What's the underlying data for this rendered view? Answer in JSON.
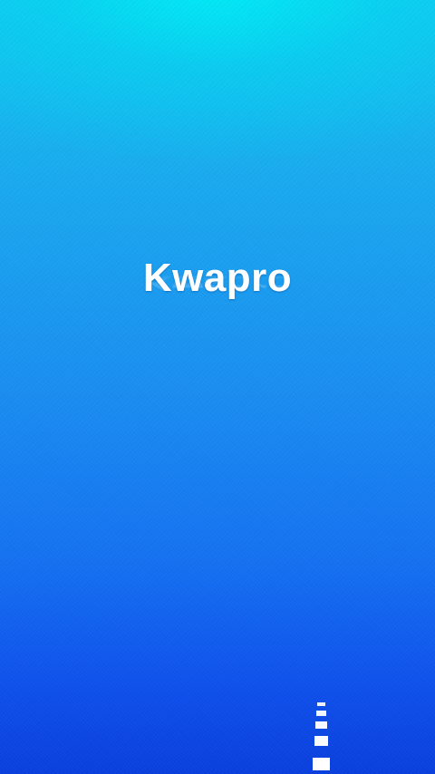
{
  "app": {
    "logo_text": "Kwapro"
  },
  "theme": {
    "background_top": "#12c6ef",
    "background_bottom": "#0a3fdd",
    "glow": "#00ebf5",
    "logo_color": "#ffffff"
  },
  "decor": {
    "road_marks": 5
  }
}
